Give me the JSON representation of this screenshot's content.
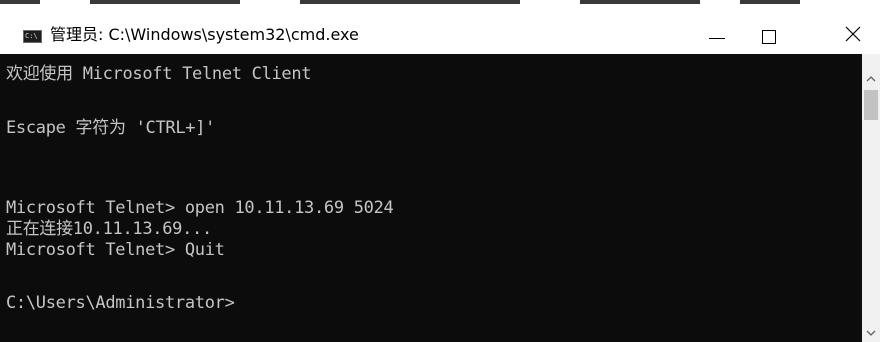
{
  "window": {
    "title": "管理员: C:\\Windows\\system32\\cmd.exe",
    "icon_text": "C:\\",
    "icon": "cmd-icon"
  },
  "controls": {
    "minimize_icon": "minimize-icon",
    "maximize_icon": "maximize-icon",
    "close_icon": "close-icon"
  },
  "console": {
    "background": "#0c0c0c",
    "text_color": "#c5c5c5",
    "lines": [
      "欢迎使用 Microsoft Telnet Client",
      "",
      "Escape 字符为 'CTRL+]'",
      "",
      "",
      "Microsoft Telnet> open 10.11.13.69 5024",
      "正在连接10.11.13.69...",
      "Microsoft Telnet> Quit",
      "",
      "C:\\Users\\Administrator>"
    ]
  },
  "scrollbar": {
    "up_icon": "scroll-up-arrow-icon",
    "down_icon": "scroll-down-arrow-icon"
  }
}
